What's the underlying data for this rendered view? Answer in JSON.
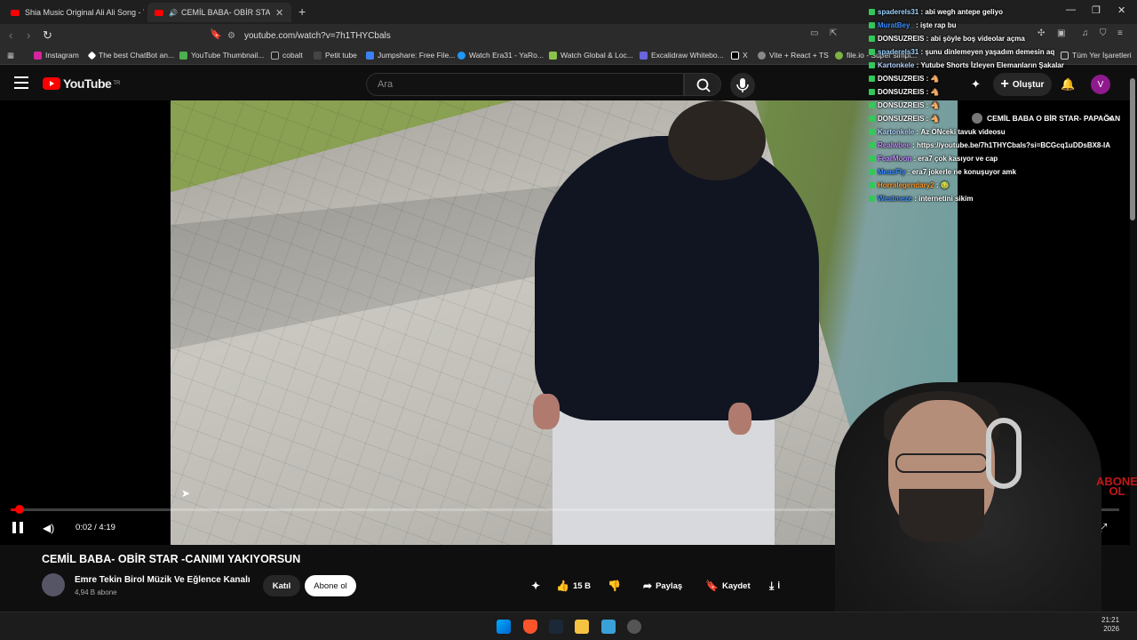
{
  "browser": {
    "tabs": [
      {
        "label": "Shia Music Original Ali Ali Song - You"
      },
      {
        "label": "CEMİL BABA- OBİR STAR -CAN"
      }
    ],
    "url": "youtube.com/watch?v=7h1THYCbals",
    "bookmarks": [
      "Instagram",
      "The best ChatBot an...",
      "YouTube Thumbnail...",
      "cobalt",
      "Petit tube",
      "Jumpshare: Free File...",
      "Watch Era31 - YaRo...",
      "Watch Global & Loc...",
      "Excalidraw Whitebo...",
      "X",
      "Vite + React + TS",
      "file.io - Super simpl...",
      "Tüm Yer İşaretleri"
    ]
  },
  "youtube": {
    "logo_text": "YouTube",
    "logo_region": "TR",
    "search_placeholder": "Ara",
    "create_label": "Oluştur",
    "avatar_letter": "V"
  },
  "player": {
    "current_time": "0:02",
    "duration": "4:19",
    "time_display": "0:02 / 4:19",
    "progress_fraction": 0.008,
    "watermark": "ABONE\nOL"
  },
  "popup": {
    "title": "CEMİL BABA O BİR STAR- PAPAĞAN"
  },
  "chat": [
    {
      "user": "spaderels31",
      "msg": "abi wegh antepe geliyo",
      "color": "#9ad3ff"
    },
    {
      "user": "MuratBey_",
      "msg": "işte rap bu",
      "color": "#3a8cff"
    },
    {
      "user": "DONSUZREIS",
      "msg": "abi şöyle boş videolar açma",
      "color": "#ffffff"
    },
    {
      "user": "spaderels31",
      "msg": "şunu dinlemeyen yaşadım demesin aq",
      "color": "#9ad3ff"
    },
    {
      "user": "Kartonkele",
      "msg": "Yutube Shorts İzleyen Elemanların Şakalar",
      "color": "#b0d0ff"
    },
    {
      "user": "DONSUZREIS",
      "msg": "🐴",
      "color": "#ffffff"
    },
    {
      "user": "DONSUZREIS",
      "msg": "🐴",
      "color": "#ffffff"
    },
    {
      "user": "DONSUZREIS",
      "msg": "🐴",
      "color": "#ffffff"
    },
    {
      "user": "DONSUZREIS",
      "msg": "🐴",
      "color": "#ffffff"
    },
    {
      "user": "Kartonkele",
      "msg": "Az ÖNceki tavuk videosu",
      "color": "#b0d0ff"
    },
    {
      "user": "Realwbee",
      "msg": "https://youtube.be/7h1THYCbals?si=BCGcq1uDDsBX8-IA",
      "color": "#c08bff"
    },
    {
      "user": "FearMoon",
      "msg": "era7 çok kasıyor ve cap",
      "color": "#c08bff"
    },
    {
      "user": "MeasFly",
      "msg": "era7 jokerle ne konuşuyor amk",
      "color": "#3a8cff"
    },
    {
      "user": "Horralegendary2",
      "msg": "🤢",
      "color": "#ff9a2a"
    },
    {
      "user": "Westmeze",
      "msg": "internetini sikim",
      "color": "#3a8cff"
    }
  ],
  "video": {
    "title": "CEMİL BABA- OBİR STAR -CANIMI YAKIYORSUN",
    "channel": "Emre Tekin Birol Müzik Ve Eğlence Kanalı",
    "subscribers": "4,94 B abone",
    "join_label": "Katıl",
    "subscribe_label": "Abone ol",
    "likes": "15 B",
    "share_label": "Paylaş",
    "save_label": "Kaydet",
    "download_label": "İ"
  },
  "taskbar": {
    "time": "21:21",
    "date": "2026"
  },
  "colors": {
    "accent": "#ff0000",
    "background": "#0f0f0f"
  }
}
